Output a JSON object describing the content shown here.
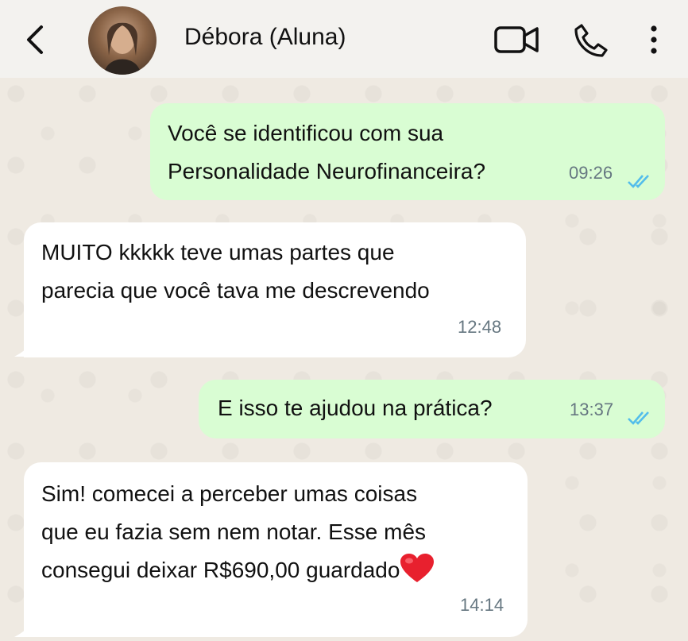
{
  "header": {
    "contact_name": "Débora (Aluna)",
    "icons": [
      "back-icon",
      "avatar",
      "video-call-icon",
      "phone-icon",
      "more-menu-icon"
    ]
  },
  "messages": [
    {
      "direction": "outgoing",
      "lines": [
        "Você se identificou com sua",
        "Personalidade Neurofinanceira?"
      ],
      "time": "09:26",
      "status": "read"
    },
    {
      "direction": "incoming",
      "lines": [
        "MUITO kkkkk teve umas partes que",
        "parecia que você tava me descrevendo"
      ],
      "time": "12:48"
    },
    {
      "direction": "outgoing",
      "lines": [
        "E isso te ajudou na prática?"
      ],
      "time": "13:37",
      "status": "read"
    },
    {
      "direction": "incoming",
      "lines": [
        "Sim! comecei a perceber umas coisas",
        "que eu fazia sem nem notar. Esse mês",
        "consegui deixar R$690,00 guardado"
      ],
      "emoji": "❤️",
      "time": "14:14"
    }
  ],
  "colors": {
    "outgoing_bubble": "#d9fdd3",
    "incoming_bubble": "#ffffff",
    "chat_background": "#efeae2",
    "read_ticks": "#53bdeb",
    "timestamp": "#667781"
  }
}
